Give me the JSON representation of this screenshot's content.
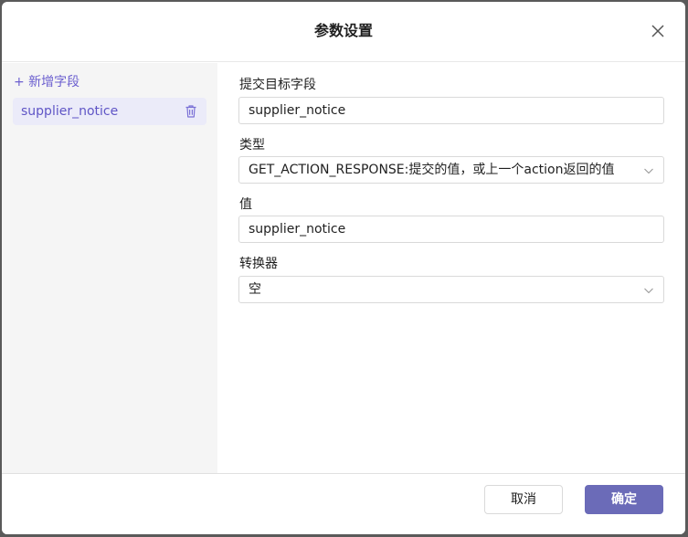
{
  "dialog": {
    "title": "参数设置"
  },
  "sidebar": {
    "add_label": "+ 新增字段",
    "items": [
      {
        "label": "supplier_notice"
      }
    ]
  },
  "form": {
    "target_field": {
      "label": "提交目标字段",
      "value": "supplier_notice"
    },
    "type": {
      "label": "类型",
      "value": "GET_ACTION_RESPONSE:提交的值，或上一个action返回的值"
    },
    "value": {
      "label": "值",
      "value": "supplier_notice"
    },
    "converter": {
      "label": "转换器",
      "value": "空"
    }
  },
  "footer": {
    "cancel_label": "取消",
    "ok_label": "确定"
  },
  "colors": {
    "accent": "#6b5fcf",
    "primary_button": "#6b6bb8",
    "sidebar_bg": "#f5f5f5",
    "selected_item_bg": "#ebebf9"
  },
  "icons": {
    "close": "close-icon",
    "delete": "trash-icon",
    "dropdown": "chevron-down-icon"
  }
}
